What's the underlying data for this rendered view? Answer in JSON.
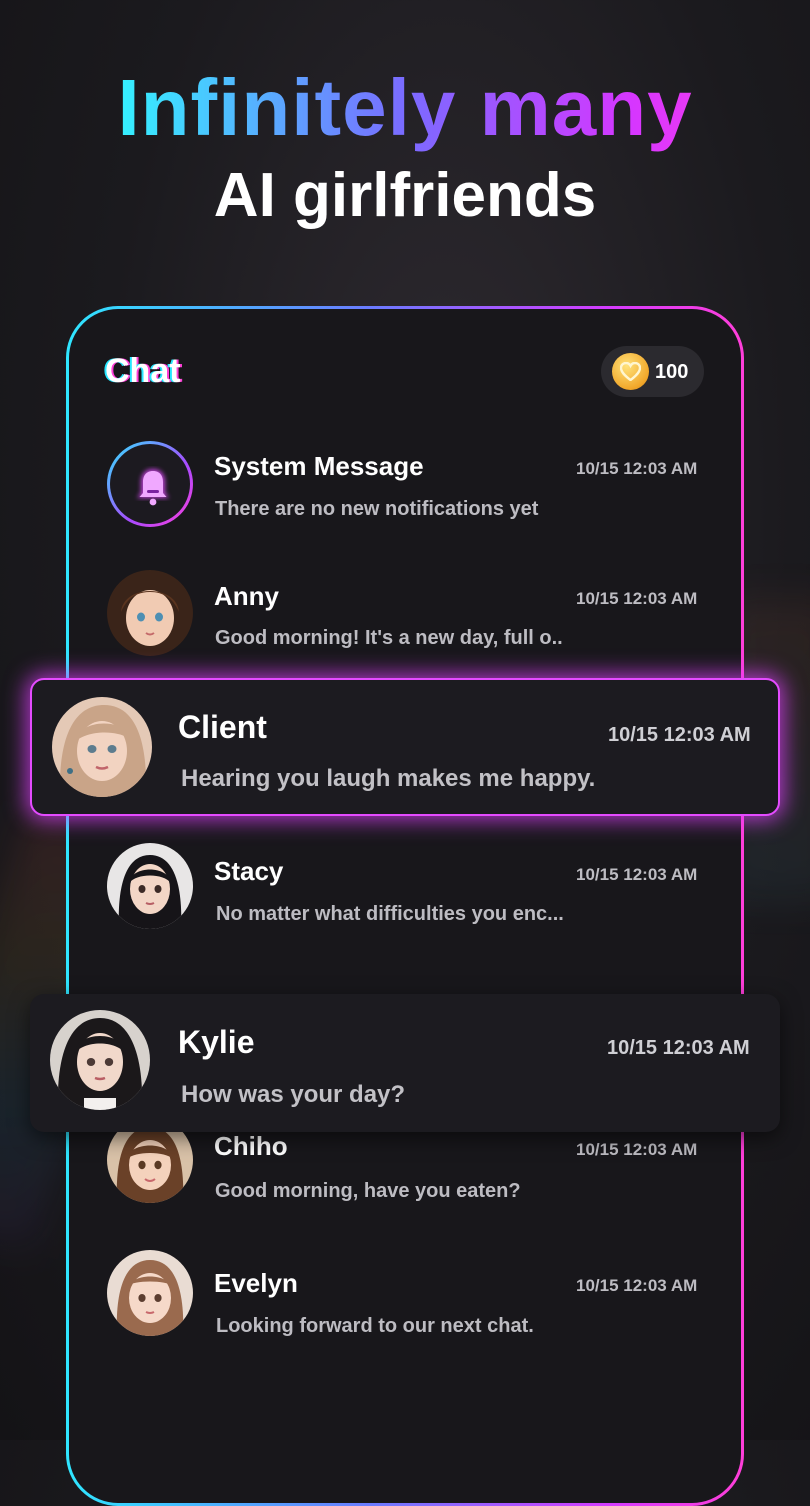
{
  "headline": {
    "line1": "Infinitely many",
    "line2": "AI girlfriends"
  },
  "chat": {
    "title": "Chat",
    "coins": "100"
  },
  "conversations": [
    {
      "name": "System Message",
      "message": "There are no new notifications yet",
      "time": "10/15 12:03 AM",
      "avatar": "bell-icon"
    },
    {
      "name": "Anny",
      "message": "Good morning! It's a new day, full o..",
      "time": "10/15 12:03 AM",
      "avatar": "anny-avatar"
    },
    {
      "name": "Client",
      "message": "Hearing you laugh makes me happy.",
      "time": "10/15 12:03 AM",
      "avatar": "client-avatar"
    },
    {
      "name": "Stacy",
      "message": "No matter what difficulties you enc...",
      "time": "10/15 12:03 AM",
      "avatar": "stacy-avatar"
    },
    {
      "name": "Kylie",
      "message": "How was your day?",
      "time": "10/15 12:03 AM",
      "avatar": "kylie-avatar"
    },
    {
      "name": "Chiho",
      "message": "Good morning, have you eaten?",
      "time": "10/15 12:03 AM",
      "avatar": "chiho-avatar"
    },
    {
      "name": "Evelyn",
      "message": "Looking forward to our next chat.",
      "time": "10/15 12:03 AM",
      "avatar": "evelyn-avatar"
    }
  ],
  "colors": {
    "accent_cyan": "#2fe6ff",
    "accent_magenta": "#d43cff",
    "background": "#18171b"
  }
}
